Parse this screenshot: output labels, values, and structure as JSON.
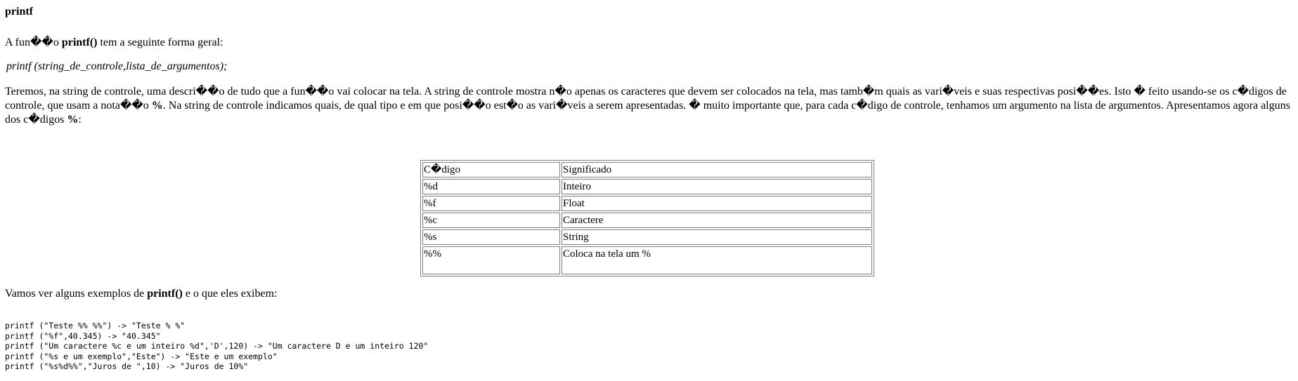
{
  "title": "printf",
  "intro": {
    "before": "A fun��o ",
    "bold": "printf()",
    "after": " tem a seguinte forma geral:"
  },
  "syntax": "printf (string_de_controle,lista_de_argumentos);",
  "description": {
    "part1": " Teremos, na string de controle, uma descri��o de tudo que a fun��o vai colocar na tela. A string de controle mostra n�o apenas os caracteres que devem ser colocados na tela, mas tamb�m quais as vari�veis e suas respectivas posi��es. Isto � feito usando-se os c�digos de controle, que usam a nota��o ",
    "bold1": "%",
    "part2": ". Na string de controle indicamos quais, de qual tipo e em que posi��o est�o as vari�veis a serem apresentadas. � muito importante que, para cada c�digo de controle, tenhamos um argumento na lista de argumentos. Apresentamos agora alguns dos c�digos ",
    "bold2": "%",
    "part3": ":"
  },
  "table": {
    "headers": [
      "C�digo",
      "Significado"
    ],
    "rows": [
      [
        "%d",
        "Inteiro"
      ],
      [
        "%f",
        "Float"
      ],
      [
        "%c",
        "Caractere"
      ],
      [
        "%s",
        "String"
      ],
      [
        "%%",
        "Coloca na tela um %"
      ]
    ]
  },
  "examples_intro": {
    "before": "Vamos ver alguns exemplos de ",
    "bold": "printf()",
    "after": " e o que eles exibem:"
  },
  "code_lines": [
    "printf (\"Teste %% %%\") -> \"Teste % %\"",
    "printf (\"%f\",40.345) -> \"40.345\"",
    "printf (\"Um caractere %c e um inteiro %d\",'D',120) -> \"Um caractere D e um inteiro 120\"",
    "printf (\"%s e um exemplo\",\"Este\") -> \"Este e um exemplo\"",
    "printf (\"%s%d%%\",\"Juros de \",10) -> \"Juros de 10%\""
  ]
}
